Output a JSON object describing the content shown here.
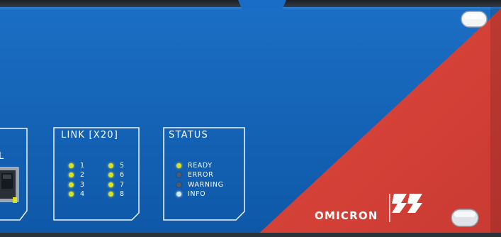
{
  "colors": {
    "panel_blue": "#1565b8",
    "accent_red": "#d8443a",
    "led_yellow": "#d9e21f",
    "led_off": "#4f5a66",
    "led_info": "#cfe9ff"
  },
  "link_panel": {
    "title": "LINK [X20]",
    "left_leds": [
      {
        "label": "1",
        "color": "yellow"
      },
      {
        "label": "2",
        "color": "yellow"
      },
      {
        "label": "3",
        "color": "yellow"
      },
      {
        "label": "4",
        "color": "yellow"
      }
    ],
    "right_leds": [
      {
        "label": "5",
        "color": "yellow"
      },
      {
        "label": "6",
        "color": "yellow"
      },
      {
        "label": "7",
        "color": "yellow"
      },
      {
        "label": "8",
        "color": "yellow"
      }
    ]
  },
  "status_panel": {
    "title": "STATUS",
    "leds": [
      {
        "label": "READY",
        "color": "yellow"
      },
      {
        "label": "ERROR",
        "color": "grey"
      },
      {
        "label": "WARNING",
        "color": "grey"
      },
      {
        "label": "INFO",
        "color": "blue"
      }
    ]
  },
  "left_panel": {
    "partial_title": "L"
  },
  "brand": {
    "name": "OMICRON"
  }
}
